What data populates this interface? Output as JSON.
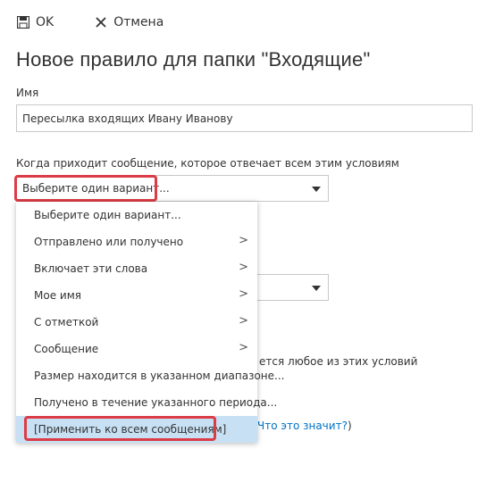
{
  "toolbar": {
    "ok_label": "OK",
    "cancel_label": "Отмена"
  },
  "page_title": "Новое правило для папки \"Входящие\"",
  "name_field": {
    "label": "Имя",
    "value": "Пересылка входящих Ивану Иванову"
  },
  "condition": {
    "label": "Когда приходит сообщение, которое отвечает всем этим условиям",
    "selected": "Выберите один вариант..."
  },
  "dropdown": {
    "items": [
      {
        "label": "Выберите один вариант...",
        "submenu": false
      },
      {
        "label": "Отправлено или получено",
        "submenu": true
      },
      {
        "label": "Включает эти слова",
        "submenu": true
      },
      {
        "label": "Мое имя",
        "submenu": true
      },
      {
        "label": "С отметкой",
        "submenu": true
      },
      {
        "label": "Сообщение",
        "submenu": true
      },
      {
        "label": "Размер находится в указанном диапазоне...",
        "submenu": false
      },
      {
        "label": "Получено в течение указанного периода...",
        "submenu": false
      },
      {
        "label": "[Применить ко всем сообщениям]",
        "submenu": false
      }
    ],
    "chevron": ">"
  },
  "background": {
    "exception_text_partial": "ется любое из этих условий",
    "help_text_partial": "Что это значит?",
    "help_close": ")"
  },
  "colors": {
    "highlight": "#dc3c45",
    "link": "#0072c6",
    "selected_bg": "#c7e0f4"
  },
  "icons": {
    "ok": "save-icon",
    "cancel": "close-icon",
    "select": "caret-down-icon",
    "submenu": "chevron-right-icon"
  }
}
